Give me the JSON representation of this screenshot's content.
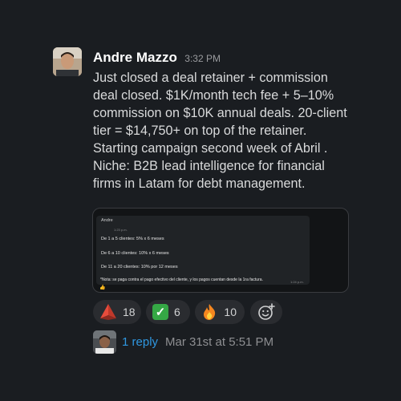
{
  "message": {
    "author": "Andre Mazzo",
    "time": "3:32 PM",
    "text": "Just closed a deal retainer + commission deal closed. $1K/month tech fee + 5–10% commission on $10K annual deals. 20-client tier = $14,750+ on top of the retainer. Starting campaign second week of Abril . Niche: B2B lead intelligence for financial firms in Latam for debt management."
  },
  "attachment": {
    "author": "Andre",
    "time": "1:23 p.m.",
    "lines": [
      "De 1 a 5 clientes: 5% x 6 meses",
      "De 6 a 10 clientes: 10% x 6 meses",
      "De 11 a 20 clientes: 10% por 12 meses"
    ],
    "note": "*Nota: se paga contra el pago efectivo del cliente, y los pagos cuentan desde la 1ra factura.",
    "note_time": "1:24 p.m.",
    "reaction": "👍"
  },
  "reactions": [
    {
      "icon": "red-triangle-icon",
      "count": "18"
    },
    {
      "icon": "check-mark-icon",
      "count": "6"
    },
    {
      "icon": "fire-icon",
      "count": "10"
    }
  ],
  "thread": {
    "reply_label": "1 reply",
    "reply_time": "Mar 31st at 5:51 PM"
  },
  "colors": {
    "background": "#1a1d21",
    "link": "#2f97e0",
    "pill": "#2a2c30"
  }
}
